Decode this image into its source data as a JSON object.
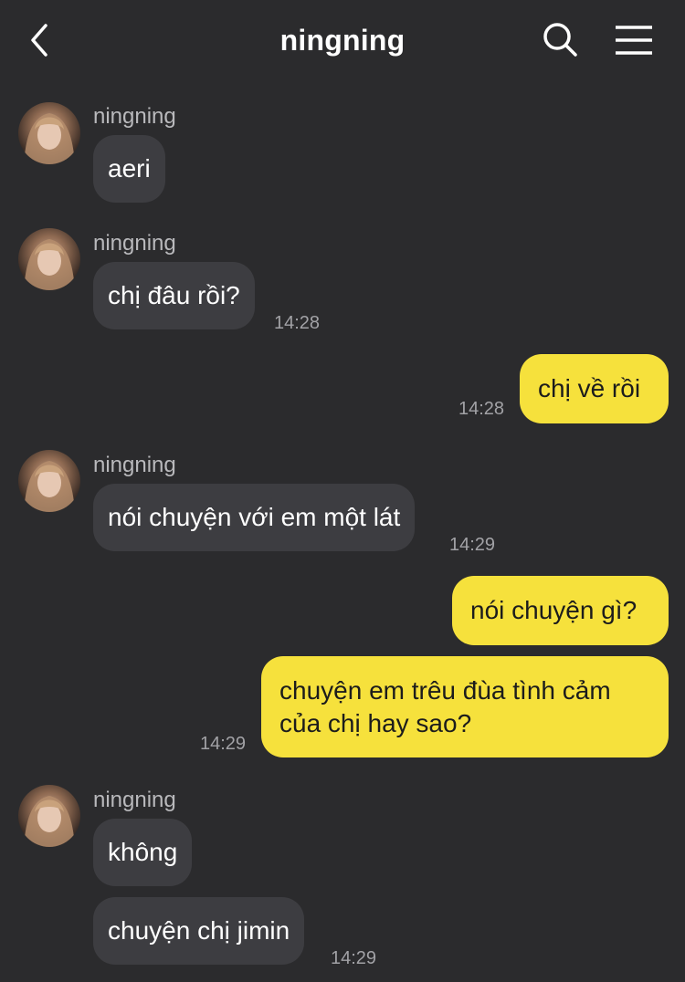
{
  "header": {
    "title": "ningning",
    "back_icon": "chevron-left-icon",
    "search_icon": "search-icon",
    "menu_icon": "hamburger-menu-icon"
  },
  "colors": {
    "background": "#2b2b2d",
    "incoming_bubble": "#3d3d41",
    "outgoing_bubble": "#f6e13c",
    "timestamp": "#a2a2a6"
  },
  "messages": [
    {
      "sender": "ningning",
      "text": "aeri",
      "time": ""
    },
    {
      "sender": "ningning",
      "text": "chị đâu rồi?",
      "time": "14:28"
    },
    {
      "sender": "me",
      "text": "chị về rồi",
      "time": "14:28"
    },
    {
      "sender": "ningning",
      "text": "nói chuyện với em một lát",
      "time": "14:29"
    },
    {
      "sender": "me",
      "text": "nói chuyện gì?",
      "time": ""
    },
    {
      "sender": "me",
      "text_line1": "chuyện em trêu đùa tình cảm",
      "text_line2": "của chị hay sao?",
      "time": "14:29"
    },
    {
      "sender": "ningning",
      "text": "không",
      "time": ""
    },
    {
      "sender": "ningning",
      "text": "chuyện chị jimin",
      "time": "14:29"
    }
  ]
}
